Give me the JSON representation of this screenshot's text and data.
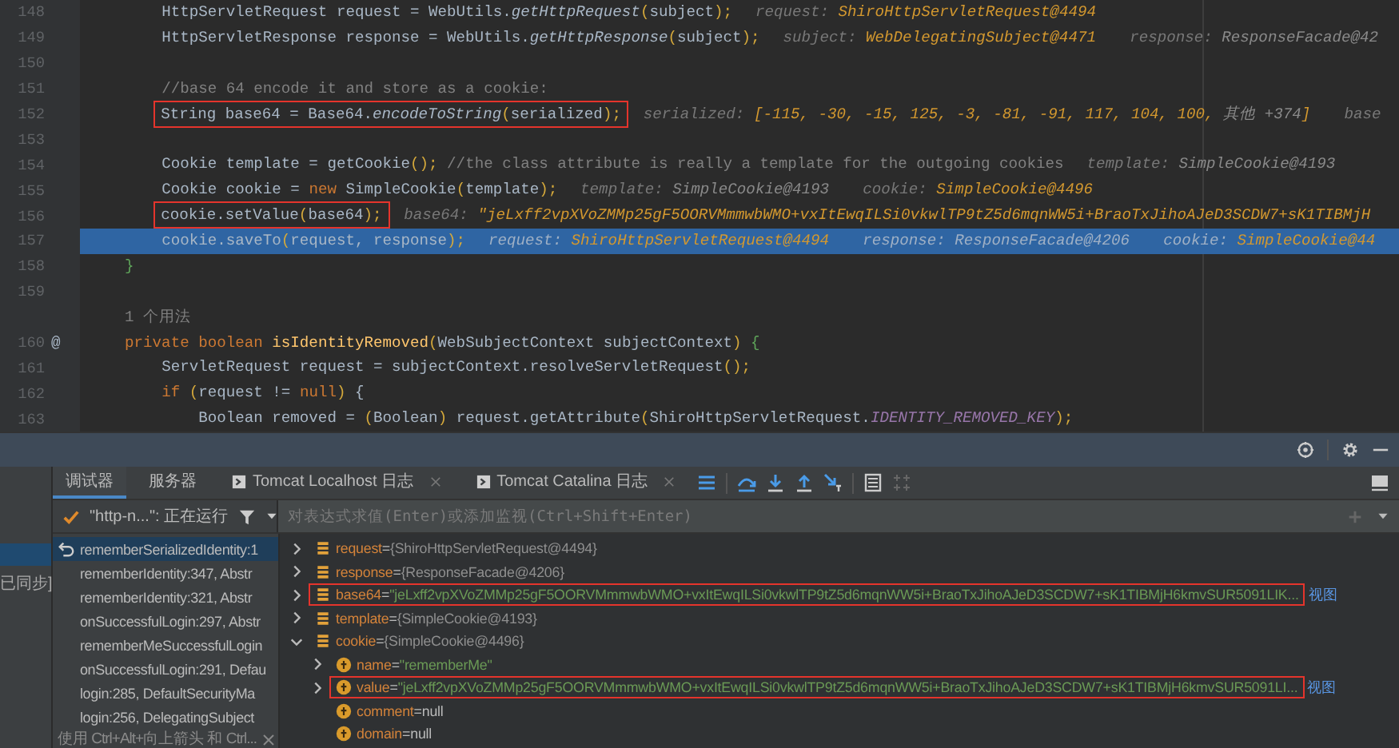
{
  "editor": {
    "lines": [
      {
        "kind": "code",
        "number": "148",
        "current": false,
        "boxed": false,
        "code": [
          {
            "t": "        HttpServletRequest request = WebUtils.",
            "kind": "plain"
          },
          {
            "t": "getHttpRequest",
            "kind": "method"
          },
          {
            "t": "(",
            "kind": "punct"
          },
          {
            "t": "subject",
            "kind": "plain"
          },
          {
            "t": ");",
            "kind": "punct"
          }
        ],
        "hints": [
          [
            {
              "t": "request: ",
              "kind": "label"
            },
            {
              "t": "ShiroHttpServletRequest@4494",
              "kind": "value"
            }
          ]
        ]
      },
      {
        "kind": "code",
        "number": "149",
        "current": false,
        "boxed": false,
        "code": [
          {
            "t": "        HttpServletResponse response = WebUtils.",
            "kind": "plain"
          },
          {
            "t": "getHttpResponse",
            "kind": "method"
          },
          {
            "t": "(",
            "kind": "punct"
          },
          {
            "t": "subject",
            "kind": "plain"
          },
          {
            "t": ");",
            "kind": "punct"
          }
        ],
        "hints": [
          [
            {
              "t": "subject: ",
              "kind": "label"
            },
            {
              "t": "WebDelegatingSubject@4471",
              "kind": "value"
            }
          ],
          [
            {
              "t": "response: ",
              "kind": "label"
            },
            {
              "t": "ResponseFacade@42",
              "kind": "muted"
            }
          ]
        ]
      },
      {
        "kind": "code",
        "number": "150",
        "current": false
      },
      {
        "kind": "code",
        "number": "151",
        "current": false,
        "boxed": false,
        "code": [
          {
            "t": "        //base 64 encode it and store as a cookie:",
            "kind": "comment"
          }
        ]
      },
      {
        "kind": "code",
        "number": "152",
        "current": false,
        "boxed": true,
        "code": [
          {
            "t": "        String base64 = Base64.",
            "kind": "plain"
          },
          {
            "t": "encodeToString",
            "kind": "method"
          },
          {
            "t": "(",
            "kind": "punct"
          },
          {
            "t": "serialized",
            "kind": "plain"
          },
          {
            "t": ");",
            "kind": "punct"
          }
        ],
        "hints": [
          [
            {
              "t": "serialized: ",
              "kind": "label"
            },
            {
              "t": "[-115, -30, -15, 125, -3, -81, -91, 117, 104, 100, ",
              "kind": "value"
            },
            {
              "t": "其他 +374",
              "kind": "muted"
            },
            {
              "t": "]",
              "kind": "value"
            }
          ],
          [
            {
              "t": "base",
              "kind": "label"
            }
          ]
        ]
      },
      {
        "kind": "code",
        "number": "153",
        "current": false
      },
      {
        "kind": "code",
        "number": "154",
        "current": false,
        "boxed": false,
        "code": [
          {
            "t": "        Cookie template = getCookie",
            "kind": "plain"
          },
          {
            "t": "();",
            "kind": "punct"
          },
          {
            "t": " //the class attribute is really a template for the outgoing cookies",
            "kind": "comment"
          }
        ],
        "hints": [
          [
            {
              "t": "template: ",
              "kind": "label"
            },
            {
              "t": "SimpleCookie@4193",
              "kind": "muted"
            }
          ]
        ]
      },
      {
        "kind": "code",
        "number": "155",
        "current": false,
        "boxed": false,
        "code": [
          {
            "t": "        Cookie cookie = ",
            "kind": "plain"
          },
          {
            "t": "new",
            "kind": "keyword"
          },
          {
            "t": " SimpleCookie",
            "kind": "plain"
          },
          {
            "t": "(",
            "kind": "punct"
          },
          {
            "t": "template",
            "kind": "plain"
          },
          {
            "t": ");",
            "kind": "punct"
          }
        ],
        "hints": [
          [
            {
              "t": "template: ",
              "kind": "label"
            },
            {
              "t": "SimpleCookie@4193",
              "kind": "muted"
            }
          ],
          [
            {
              "t": "cookie: ",
              "kind": "label"
            },
            {
              "t": "SimpleCookie@4496",
              "kind": "value"
            }
          ]
        ]
      },
      {
        "kind": "code",
        "number": "156",
        "current": false,
        "boxed": true,
        "code": [
          {
            "t": "        cookie.setValue",
            "kind": "plain"
          },
          {
            "t": "(",
            "kind": "punct"
          },
          {
            "t": "base64",
            "kind": "plain"
          },
          {
            "t": ");",
            "kind": "punct"
          }
        ],
        "hints": [
          [
            {
              "t": "base64: ",
              "kind": "label"
            },
            {
              "t": "\"jeLxff2vpXVoZMMp25gF5OORVMmmwbWMO+vxItEwqILSi0vkwlTP9tZ5d6mqnWW5i+BraoTxJihoAJeD3SCDW7+sK1TIBMjH",
              "kind": "value"
            }
          ]
        ]
      },
      {
        "kind": "code",
        "number": "157",
        "current": true,
        "boxed": false,
        "code": [
          {
            "t": "        cookie.saveTo",
            "kind": "plain"
          },
          {
            "t": "(",
            "kind": "punct"
          },
          {
            "t": "request, response",
            "kind": "plain"
          },
          {
            "t": ");",
            "kind": "punct"
          }
        ],
        "hints": [
          [
            {
              "t": "request: ",
              "kind": "label"
            },
            {
              "t": "ShiroHttpServletRequest@4494",
              "kind": "value"
            }
          ],
          [
            {
              "t": "response: ",
              "kind": "label"
            },
            {
              "t": "ResponseFacade@4206",
              "kind": "muted"
            }
          ],
          [
            {
              "t": "cookie: ",
              "kind": "label"
            },
            {
              "t": "SimpleCookie@44",
              "kind": "value"
            }
          ]
        ]
      },
      {
        "kind": "code",
        "number": "158",
        "current": false,
        "boxed": false,
        "code": [
          {
            "t": "    }",
            "kind": "brace"
          }
        ]
      },
      {
        "kind": "code",
        "number": "159",
        "current": false
      },
      {
        "kind": "usage",
        "text": "    1 个用法"
      },
      {
        "kind": "code",
        "number": "160",
        "mark": "@",
        "current": false,
        "boxed": false,
        "code": [
          {
            "t": "    private boolean ",
            "kind": "keyword"
          },
          {
            "t": "isIdentityRemoved",
            "kind": "declaration"
          },
          {
            "t": "(",
            "kind": "punct"
          },
          {
            "t": "WebSubjectContext subjectContext",
            "kind": "plain"
          },
          {
            "t": ") ",
            "kind": "punct"
          },
          {
            "t": "{",
            "kind": "brace"
          }
        ]
      },
      {
        "kind": "code",
        "number": "161",
        "current": false,
        "boxed": false,
        "code": [
          {
            "t": "        ServletRequest request = subjectContext.resolveServletRequest",
            "kind": "plain"
          },
          {
            "t": "();",
            "kind": "punct"
          }
        ]
      },
      {
        "kind": "code",
        "number": "162",
        "current": false,
        "boxed": false,
        "code": [
          {
            "t": "        if ",
            "kind": "keyword"
          },
          {
            "t": "(",
            "kind": "punct"
          },
          {
            "t": "request != ",
            "kind": "plain"
          },
          {
            "t": "null",
            "kind": "keyword"
          },
          {
            "t": ") ",
            "kind": "punct"
          },
          {
            "t": "{",
            "kind": "plain"
          }
        ]
      },
      {
        "kind": "code",
        "number": "163",
        "current": false,
        "boxed": false,
        "code": [
          {
            "t": "            Boolean removed = ",
            "kind": "plain"
          },
          {
            "t": "(",
            "kind": "punct"
          },
          {
            "t": "Boolean",
            "kind": "plain"
          },
          {
            "t": ") ",
            "kind": "punct"
          },
          {
            "t": "request.getAttribute",
            "kind": "plain"
          },
          {
            "t": "(",
            "kind": "punct"
          },
          {
            "t": "ShiroHttpServletRequest.",
            "kind": "plain"
          },
          {
            "t": "IDENTITY_REMOVED_KEY",
            "kind": "constant"
          },
          {
            "t": ");",
            "kind": "punct"
          }
        ]
      }
    ]
  },
  "side_strip": {
    "text": "已同步]"
  },
  "debugger": {
    "tabs": [
      {
        "label": "调试器",
        "selected": true,
        "closable": false
      },
      {
        "label": "服务器",
        "selected": false,
        "closable": false
      },
      {
        "label": "Tomcat Localhost 日志",
        "selected": false,
        "closable": true
      },
      {
        "label": "Tomcat Catalina 日志",
        "selected": false,
        "closable": true
      }
    ],
    "thread": {
      "label": "\"http-n...\": 正在运行"
    },
    "evaluate": {
      "placeholder": "对表达式求值(Enter)或添加监视(Ctrl+Shift+Enter)"
    },
    "frames": [
      {
        "label": "rememberSerializedIdentity:1",
        "selected": true
      },
      {
        "label": "rememberIdentity:347, Abstr",
        "selected": false
      },
      {
        "label": "rememberIdentity:321, Abstr",
        "selected": false
      },
      {
        "label": "onSuccessfulLogin:297, Abstr",
        "selected": false
      },
      {
        "label": "rememberMeSuccessfulLogin",
        "selected": false
      },
      {
        "label": "onSuccessfulLogin:291, Defau",
        "selected": false
      },
      {
        "label": "login:285, DefaultSecurityMa",
        "selected": false
      },
      {
        "label": "login:256, DelegatingSubject",
        "selected": false
      }
    ],
    "frames_hint": "使用 Ctrl+Alt+向上箭头 和 Ctrl...",
    "variables": [
      {
        "kind": "object",
        "name": "request",
        "eq": "=",
        "value": "{ShiroHttpServletRequest@4494}",
        "expanded": false,
        "boxed": false
      },
      {
        "kind": "object",
        "name": "response",
        "eq": "=",
        "value": "{ResponseFacade@4206}",
        "expanded": false,
        "boxed": false
      },
      {
        "kind": "string",
        "name": "base64",
        "eq": "=",
        "value": "\"jeLxff2vpXVoZMMp25gF5OORVMmmwbWMO+vxItEwqILSi0vkwlTP9tZ5d6mqnWW5i+BraoTxJihoAJeD3SCDW7+sK1TIBMjH6kmvSUR5091LIK...",
        "link": "视图",
        "expanded": false,
        "boxed": true
      },
      {
        "kind": "object",
        "name": "template",
        "eq": "=",
        "value": "{SimpleCookie@4193}",
        "expanded": false,
        "boxed": false
      },
      {
        "kind": "object",
        "name": "cookie",
        "eq": "=",
        "value": "{SimpleCookie@4496}",
        "expanded": true,
        "boxed": false,
        "children": [
          {
            "kind": "string",
            "name": "name",
            "eq": "=",
            "value": "\"rememberMe\"",
            "expanded": false,
            "boxed": false
          },
          {
            "kind": "string",
            "name": "value",
            "eq": "=",
            "value": "\"jeLxff2vpXVoZMMp25gF5OORVMmmwbWMO+vxItEwqILSi0vkwlTP9tZ5d6mqnWW5i+BraoTxJihoAJeD3SCDW7+sK1TIBMjH6kmvSUR5091LI...",
            "link": "视图",
            "expanded": false,
            "boxed": true
          },
          {
            "kind": "null",
            "name": "comment",
            "eq": "=",
            "value": "null",
            "boxed": false
          },
          {
            "kind": "null",
            "name": "domain",
            "eq": "=",
            "value": "null",
            "boxed": false
          }
        ]
      }
    ]
  }
}
